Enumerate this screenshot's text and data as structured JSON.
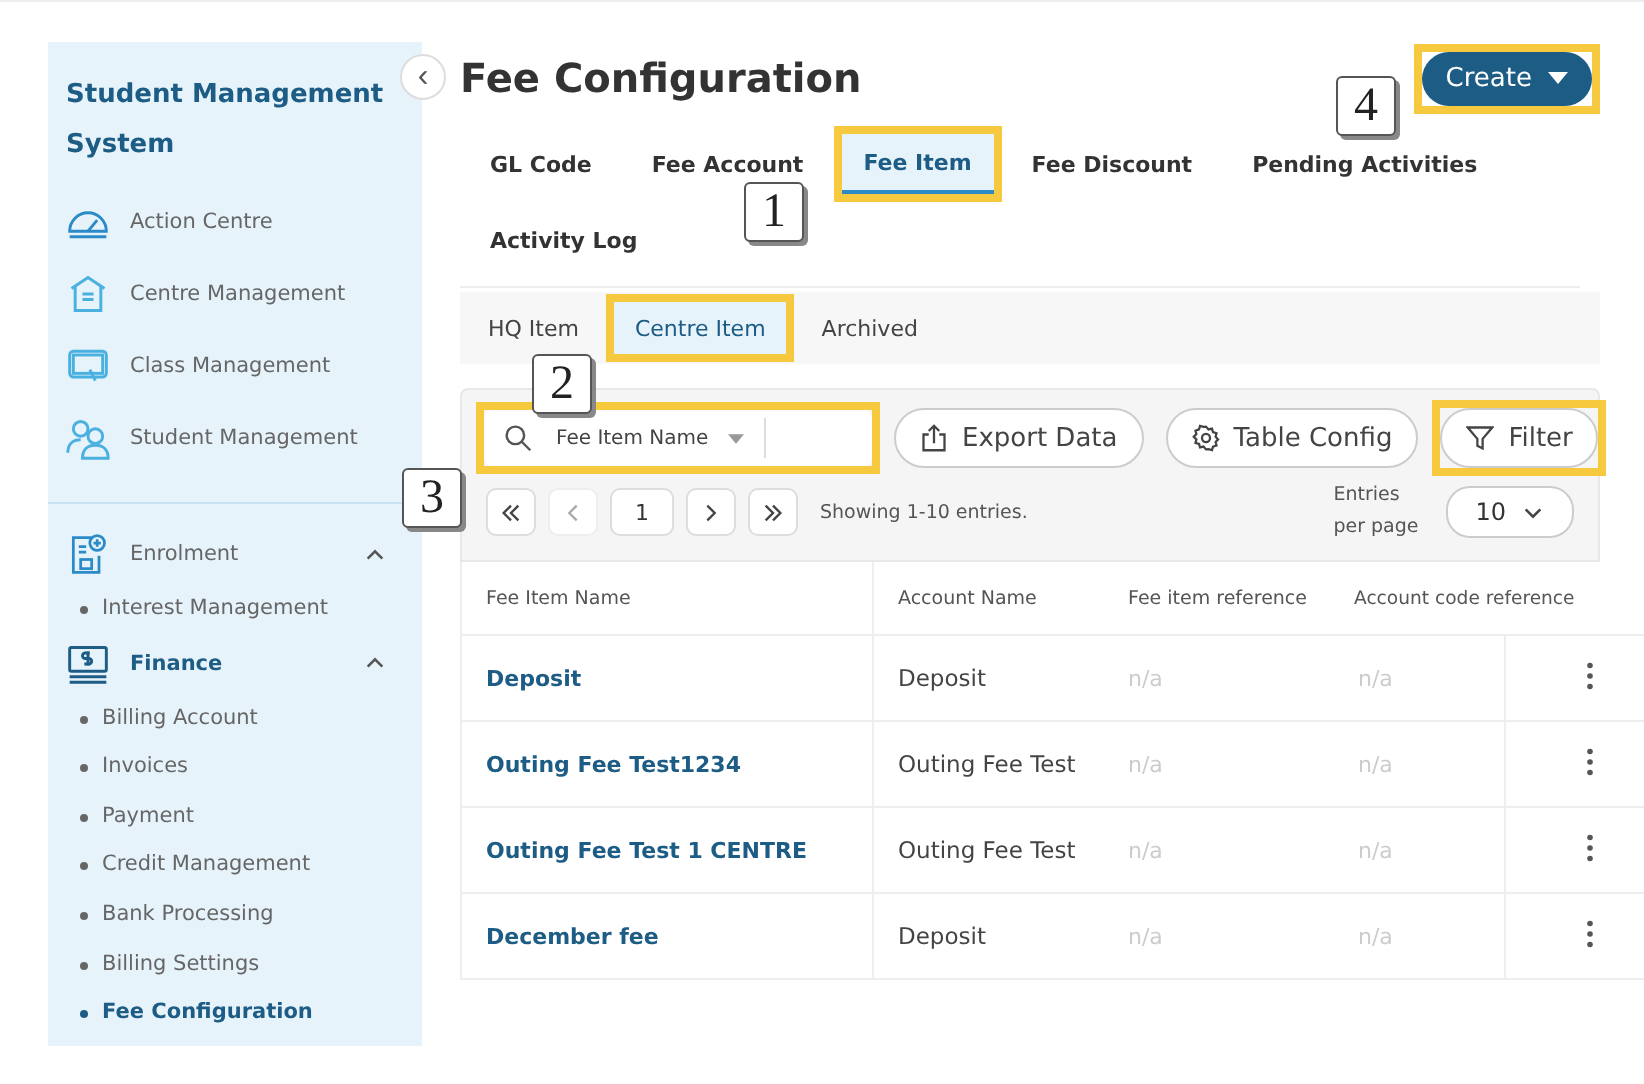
{
  "sidebar": {
    "title": "Student Management System",
    "collapse_icon": "‹",
    "items": [
      {
        "label": "Action Centre",
        "kind": "gauge"
      },
      {
        "label": "Centre Management",
        "kind": "building"
      },
      {
        "label": "Class Management",
        "kind": "board"
      },
      {
        "label": "Student Management",
        "kind": "people"
      }
    ],
    "groups": [
      {
        "label": "Enrolment",
        "kind": "form",
        "selected": false,
        "expanded": true,
        "children": [
          {
            "label": "Interest Management",
            "selected": false
          }
        ]
      },
      {
        "label": "Finance",
        "kind": "money",
        "selected": true,
        "expanded": true,
        "children": [
          {
            "label": "Billing Account",
            "selected": false
          },
          {
            "label": "Invoices",
            "selected": false
          },
          {
            "label": "Payment",
            "selected": false
          },
          {
            "label": "Credit Management",
            "selected": false
          },
          {
            "label": "Bank Processing",
            "selected": false
          },
          {
            "label": "Billing Settings",
            "selected": false
          },
          {
            "label": "Fee Configuration",
            "selected": true
          }
        ]
      }
    ]
  },
  "page_title": "Fee Configuration",
  "create_button": {
    "label": "Create",
    "highlighted": true
  },
  "tabs": [
    {
      "label": "GL Code",
      "selected": false,
      "highlighted": false
    },
    {
      "label": "Fee Account",
      "selected": false,
      "highlighted": false
    },
    {
      "label": "Fee Item",
      "selected": true,
      "highlighted": true
    },
    {
      "label": "Fee Discount",
      "selected": false,
      "highlighted": false
    },
    {
      "label": "Pending Activities",
      "selected": false,
      "highlighted": false
    },
    {
      "label": "Activity Log",
      "selected": false,
      "highlighted": false
    }
  ],
  "subtabs": [
    {
      "label": "HQ Item",
      "selected": false,
      "highlighted": false
    },
    {
      "label": "Centre Item",
      "selected": true,
      "highlighted": true
    },
    {
      "label": "Archived",
      "selected": false,
      "highlighted": false
    }
  ],
  "toolbar": {
    "search": {
      "field": "Fee Item Name",
      "highlighted": true
    },
    "buttons": [
      {
        "label": "Export Data",
        "kind": "upload",
        "highlighted": false
      },
      {
        "label": "Table Config",
        "kind": "gear",
        "highlighted": false
      },
      {
        "label": "Filter",
        "kind": "filter",
        "highlighted": true
      }
    ],
    "page": "1",
    "showing": "Showing 1-10 entries.",
    "entries_label": "Entries per page",
    "entries_value": "10"
  },
  "table": {
    "columns": [
      "Fee Item Name",
      "Account Name",
      "Fee item reference",
      "Account code reference"
    ],
    "rows": [
      [
        "Deposit",
        "Deposit",
        "n/a",
        "n/a"
      ],
      [
        "Outing Fee Test1234",
        "Outing Fee Test",
        "n/a",
        "n/a"
      ],
      [
        "Outing Fee Test 1 CENTRE",
        "Outing Fee Test",
        "n/a",
        "n/a"
      ],
      [
        "December fee",
        "Deposit",
        "n/a",
        "n/a"
      ]
    ]
  },
  "callouts": [
    "1",
    "2",
    "3",
    "4"
  ]
}
